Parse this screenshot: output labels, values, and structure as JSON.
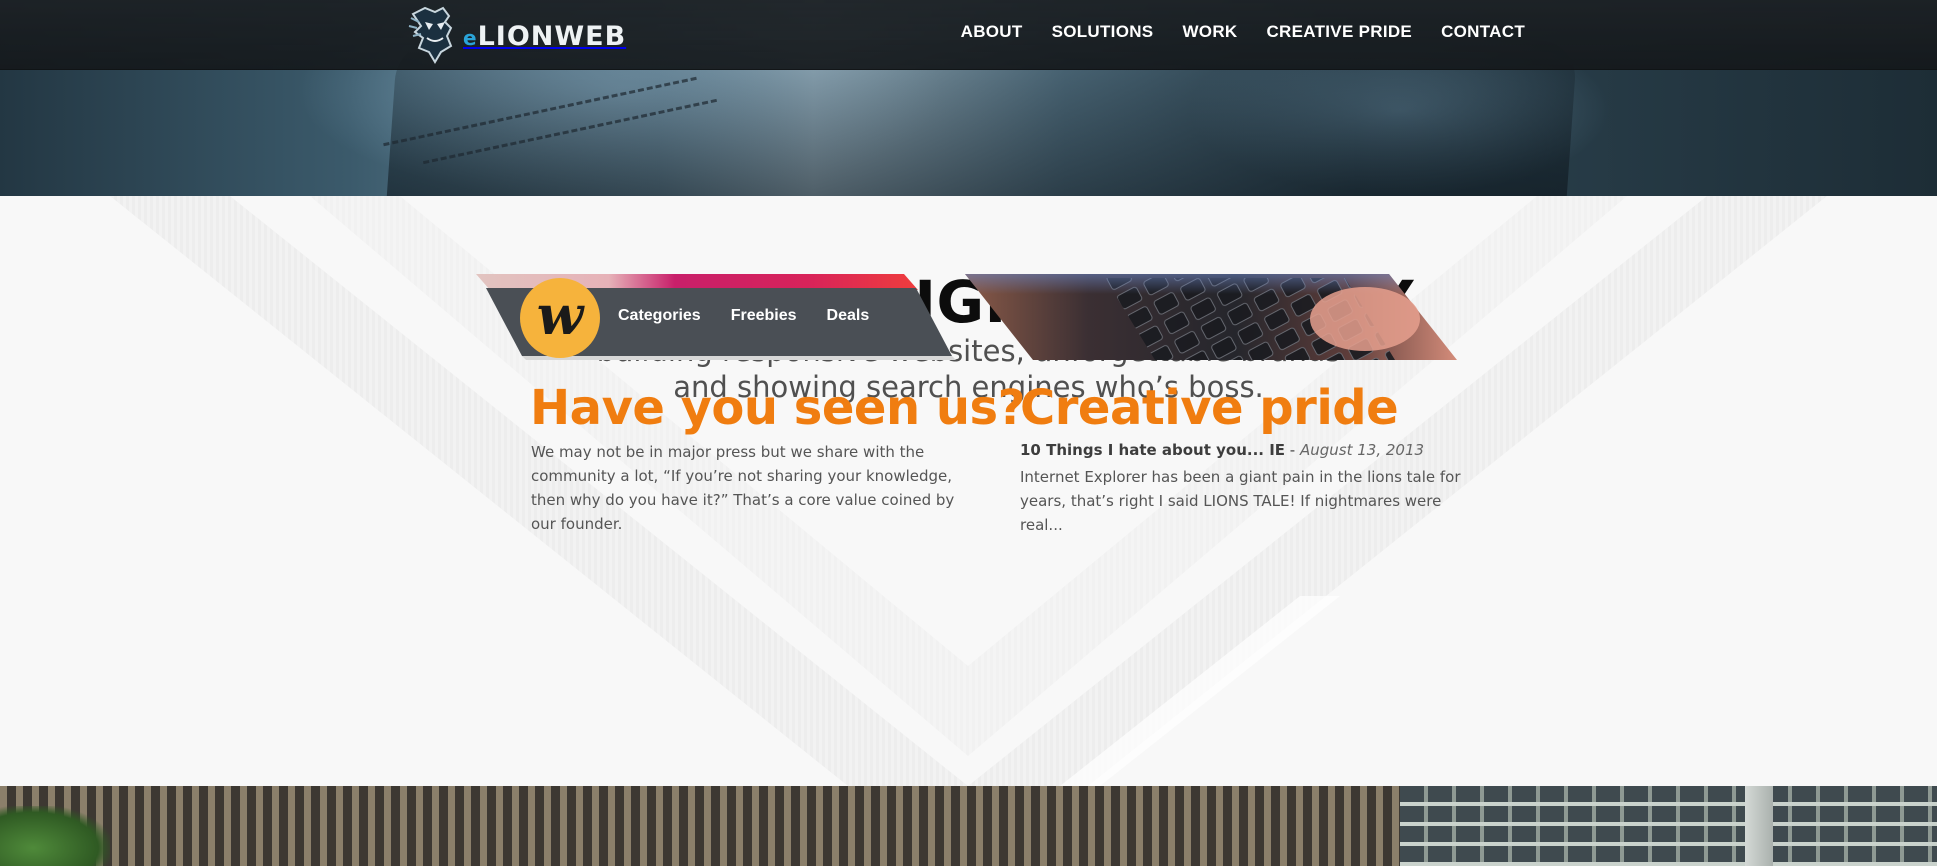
{
  "header": {
    "logo_prefix": "e",
    "logo_text": "LIONWEB",
    "nav": [
      {
        "label": "ABOUT"
      },
      {
        "label": "SOLUTIONS"
      },
      {
        "label": "WORK"
      },
      {
        "label": "CREATIVE PRIDE"
      },
      {
        "label": "CONTACT"
      }
    ]
  },
  "intro": {
    "headline": "WE ARE A DIGITAL AGENCY",
    "subline_1": "building responsive websites, unforgettable brands",
    "subline_2": "and showing search engines who’s boss."
  },
  "card_left": {
    "badge_letter": "w",
    "menu": [
      {
        "label": "Categories"
      },
      {
        "label": "Freebies"
      },
      {
        "label": "Deals"
      }
    ],
    "title": "Have you seen us?",
    "text": "We may not be in major press but we share with the community a lot, “If you’re not sharing your knowledge, then why do you have it?” That’s a core value coined by our founder."
  },
  "card_right": {
    "title": "Creative pride",
    "post_title": "10 Things I hate about you... IE",
    "post_separator": " - ",
    "post_date": "August 13, 2013",
    "text": "Internet Explorer has been a giant pain in the lions tale for years, that’s right I said LIONS TALE! If nightmares were real..."
  },
  "colors": {
    "accent_orange": "#f07d10",
    "brand_blue": "#2aa3d8",
    "badge_yellow": "#f6b33c",
    "topbar": "#1c2125"
  }
}
